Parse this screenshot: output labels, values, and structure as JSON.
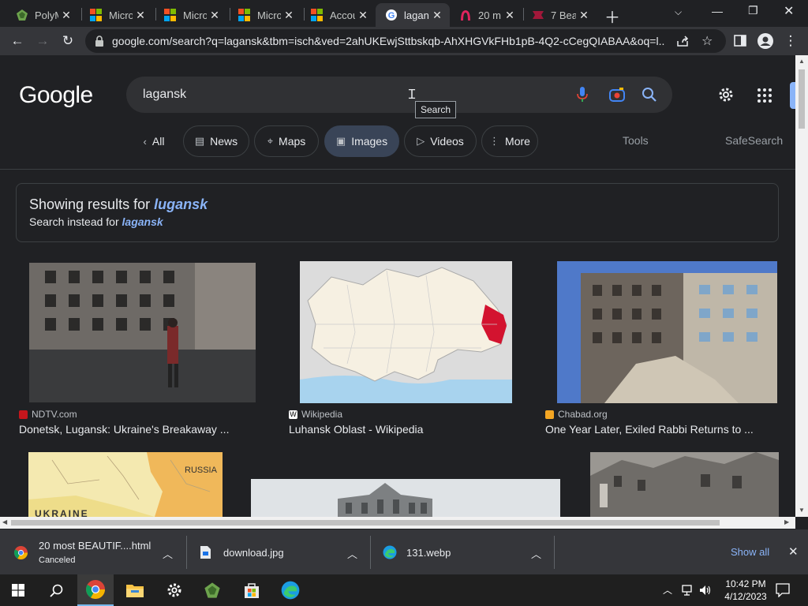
{
  "tabs": [
    {
      "title": "PolyM",
      "icon": "polymail-icon"
    },
    {
      "title": "Micro",
      "icon": "microsoft-icon"
    },
    {
      "title": "Micro",
      "icon": "microsoft-icon"
    },
    {
      "title": "Micro",
      "icon": "microsoft-icon"
    },
    {
      "title": "Accou",
      "icon": "microsoft-icon"
    },
    {
      "title": "lagan",
      "icon": "google-icon",
      "active": true
    },
    {
      "title": "20 m",
      "icon": "arch-icon"
    },
    {
      "title": "7 Bea",
      "icon": "ribbon-icon"
    }
  ],
  "toolbar": {
    "url": "google.com/search?q=lagansk&tbm=isch&ved=2ahUKEwjSttbskqb-AhXHGVkFHb1pB-4Q2-cCegQIABAA&oq=l..."
  },
  "google": {
    "logo": "Google",
    "query": "lagansk",
    "tooltip": "Search"
  },
  "chips": [
    {
      "label": "All",
      "icon": "chevron-left-icon"
    },
    {
      "label": "News",
      "icon": "news-icon"
    },
    {
      "label": "Maps",
      "icon": "map-pin-icon"
    },
    {
      "label": "Images",
      "icon": "image-icon",
      "selected": true
    },
    {
      "label": "Videos",
      "icon": "video-icon"
    },
    {
      "label": "More",
      "icon": "more-vert-icon"
    }
  ],
  "tools_label": "Tools",
  "safesearch_label": "SafeSearch",
  "correction": {
    "showing_prefix": "Showing results for ",
    "showing_term": "lugansk",
    "instead_prefix": "Search instead for ",
    "instead_term": "lagansk"
  },
  "results": [
    {
      "source": "NDTV.com",
      "caption": "Donetsk, Lugansk: Ukraine's Breakaway ..."
    },
    {
      "source": "Wikipedia",
      "caption": "Luhansk Oblast - Wikipedia"
    },
    {
      "source": "Chabad.org",
      "caption": "One Year Later, Exiled Rabbi Returns to ..."
    },
    {
      "map_label_1": "RUSSIA",
      "map_label_2": "UKRAINE"
    }
  ],
  "downloads": [
    {
      "name": "20 most BEAUTIF....html",
      "status": "Canceled",
      "icon": "chrome-icon"
    },
    {
      "name": "download.jpg",
      "icon": "file-icon"
    },
    {
      "name": "131.webp",
      "icon": "edge-icon"
    }
  ],
  "downloads_show_all": "Show all",
  "clock": {
    "time": "10:42 PM",
    "date": "4/12/2023"
  },
  "colors": {
    "accent": "#8ab4f8",
    "chip_selected": "#394457",
    "background": "#202124"
  }
}
